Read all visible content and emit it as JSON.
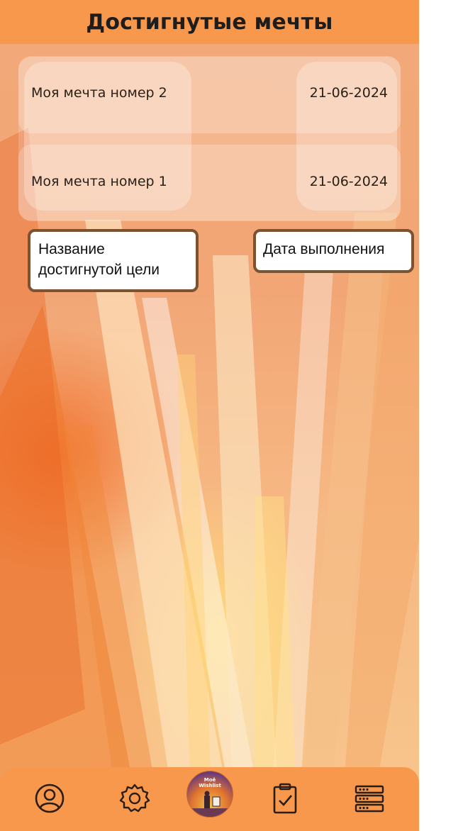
{
  "header": {
    "title": "Достигнутые мечты"
  },
  "dreams": [
    {
      "name": "Моя мечта номер 2",
      "date": "21-06-2024"
    },
    {
      "name": "Моя мечта номер 1",
      "date": "21-06-2024"
    }
  ],
  "annotations": {
    "name_line1": "Название",
    "name_line2": "достигнутой цели",
    "date": "Дата выполнения"
  },
  "navbar": {
    "items": [
      "profile-icon",
      "settings-icon",
      "home-logo",
      "tasks-icon",
      "list-icon"
    ],
    "home_caption_line1": "Моё",
    "home_caption_line2": "Wishlist"
  },
  "colors": {
    "header": "#f8984c",
    "navbar": "#f8984c",
    "annotation_border": "#7a5332"
  }
}
